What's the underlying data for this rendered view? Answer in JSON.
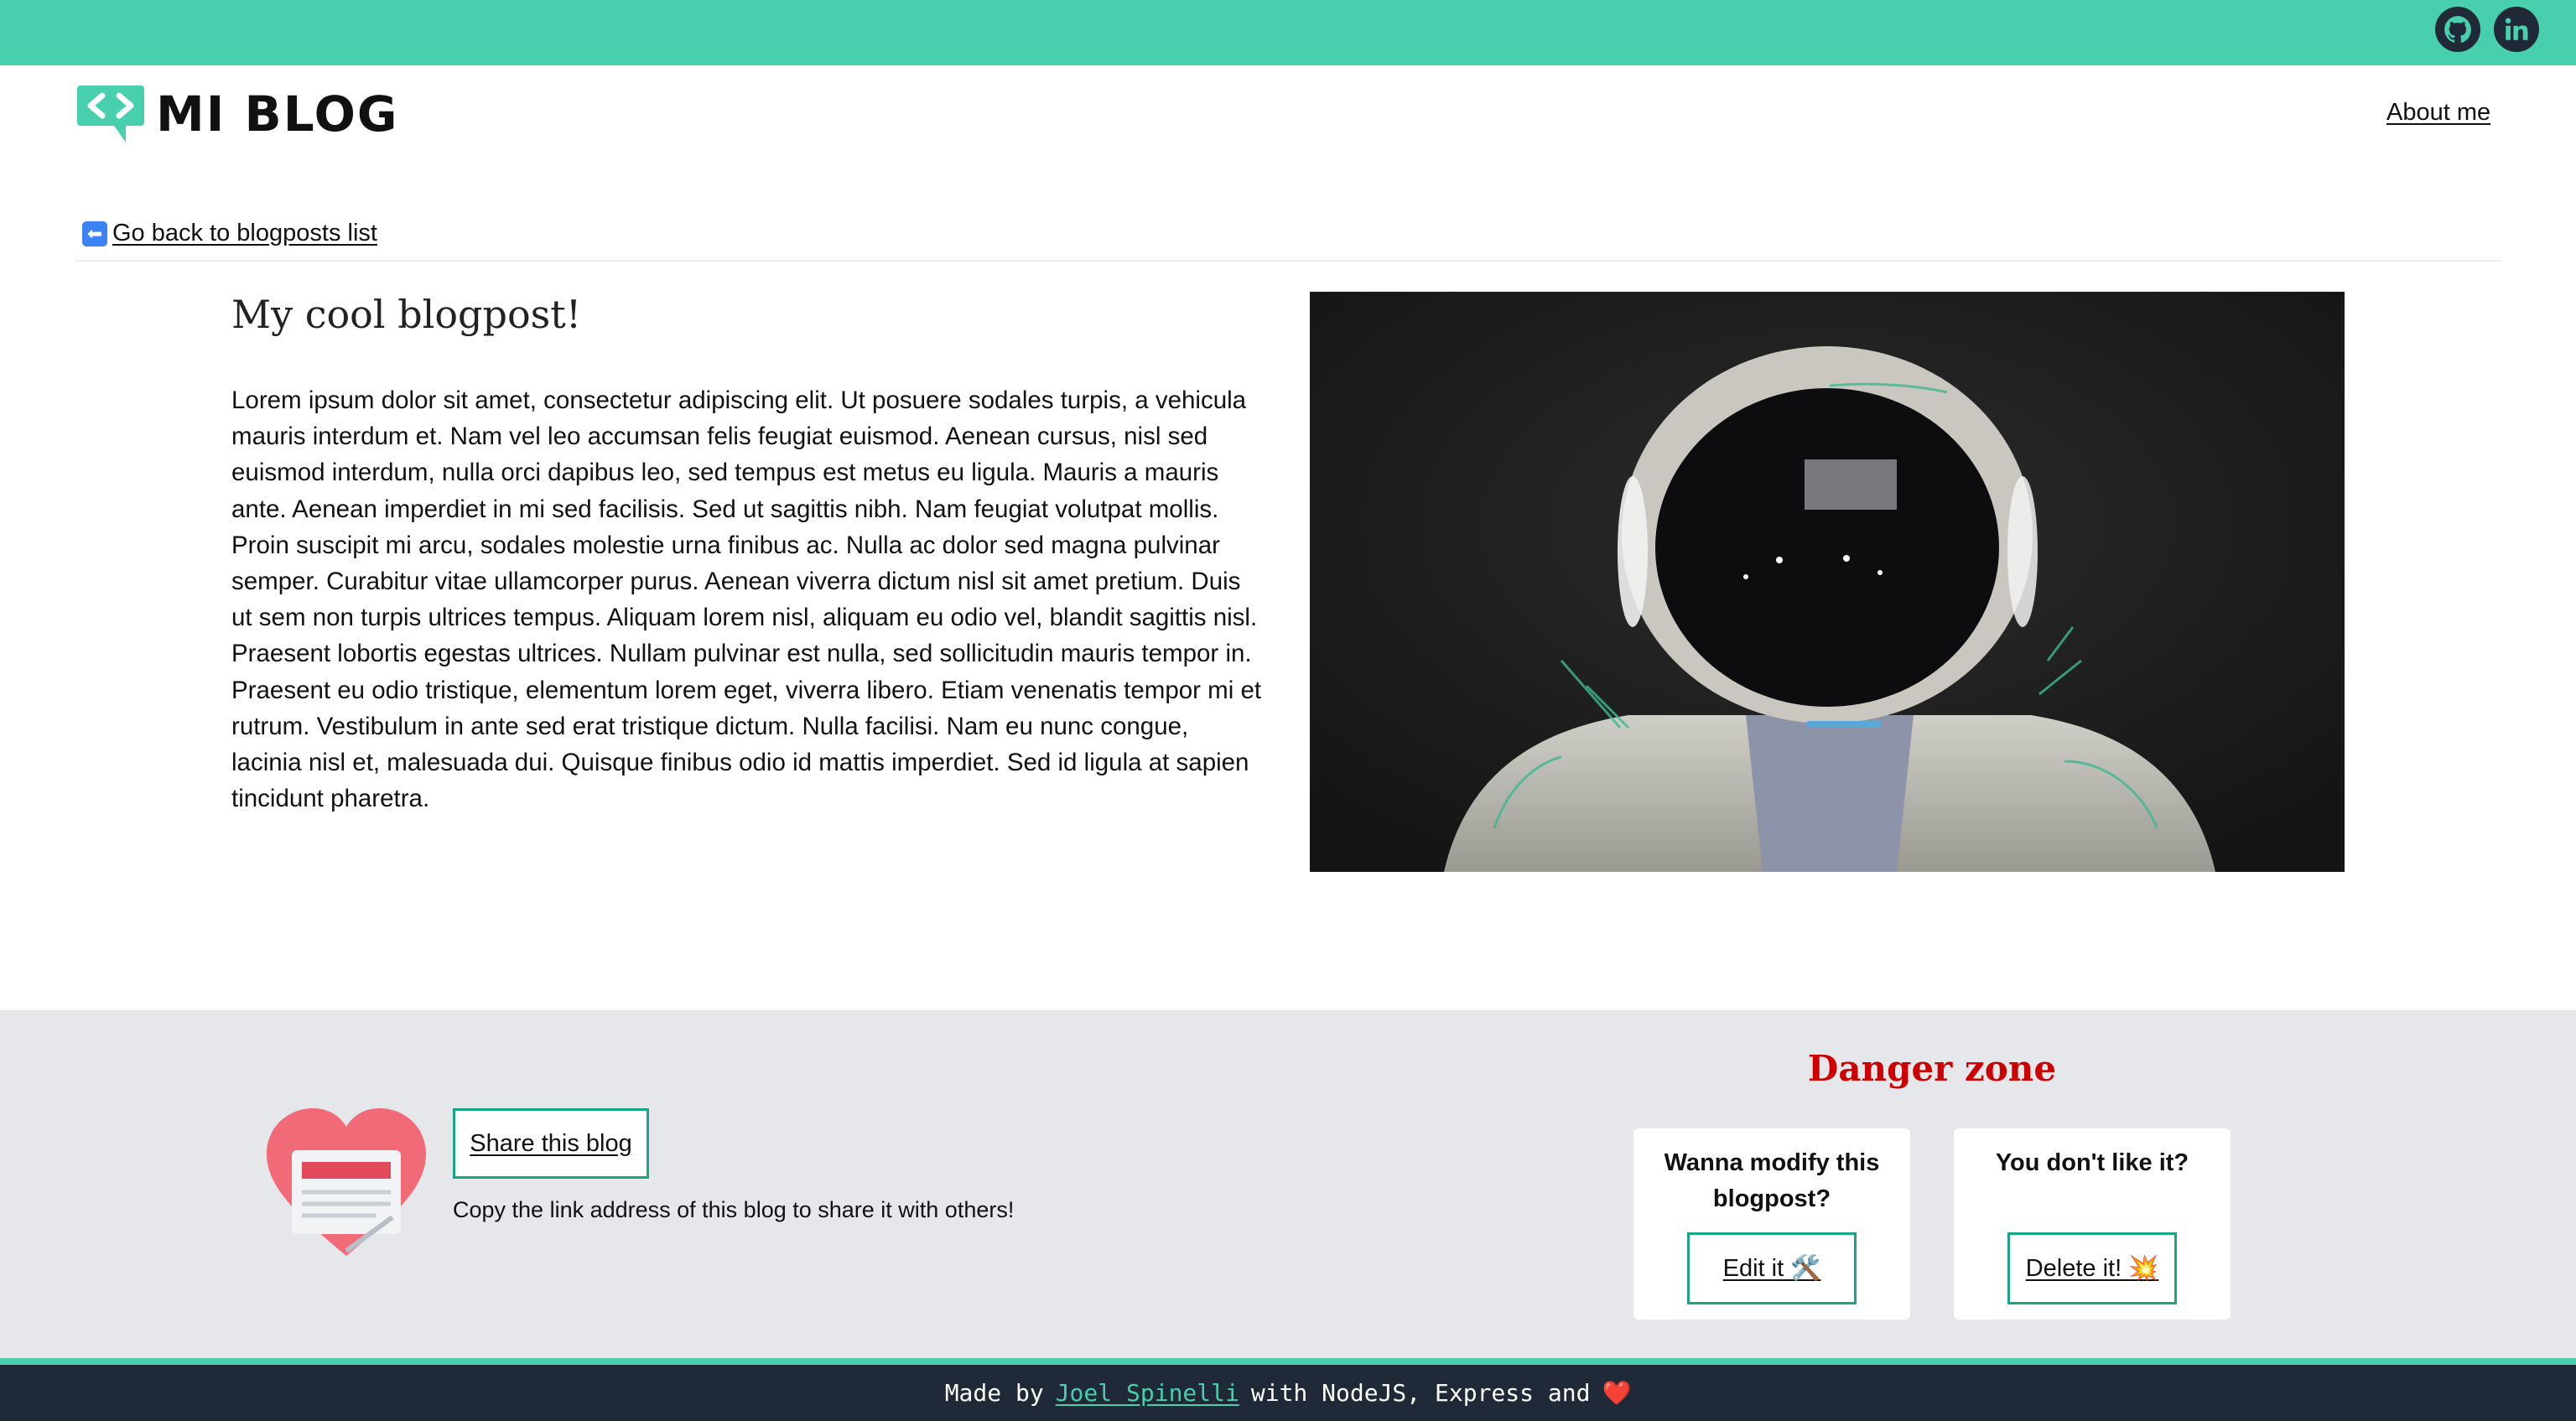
{
  "header": {
    "logo_text": "MI BLOG",
    "about_link": "About me",
    "social": [
      "github-icon",
      "linkedin-icon"
    ]
  },
  "nav": {
    "back_link": "Go back to blogposts list"
  },
  "post": {
    "title": "My cool blogpost!",
    "body": "Lorem ipsum dolor sit amet, consectetur adipiscing elit. Ut posuere sodales turpis, a vehicula mauris interdum et. Nam vel leo accumsan felis feugiat euismod. Aenean cursus, nisl sed euismod interdum, nulla orci dapibus leo, sed tempus est metus eu ligula. Mauris a mauris ante. Aenean imperdiet in mi sed facilisis. Sed ut sagittis nibh. Nam feugiat volutpat mollis. Proin suscipit mi arcu, sodales molestie urna finibus ac. Nulla ac dolor sed magna pulvinar semper. Curabitur vitae ullamcorper purus. Aenean viverra dictum nisl sit amet pretium. Duis ut sem non turpis ultrices tempus. Aliquam lorem nisl, aliquam eu odio vel, blandit sagittis nisl. Praesent lobortis egestas ultrices. Nullam pulvinar est nulla, sed sollicitudin mauris tempor in. Praesent eu odio tristique, elementum lorem eget, viverra libero. Etiam venenatis tempor mi et rutrum. Vestibulum in ante sed erat tristique dictum. Nulla facilisi. Nam eu nunc congue, lacinia nisl et, malesuada dui. Quisque finibus odio id mattis imperdiet. Sed id ligula at sapien tincidunt pharetra."
  },
  "share": {
    "button": "Share this blog",
    "description": "Copy the link address of this blog to share it with others!"
  },
  "danger": {
    "title": "Danger zone",
    "modify_question": "Wanna modify this blogpost?",
    "modify_button": "Edit it 🛠️",
    "delete_question": "You don't like it?",
    "delete_button": "Delete it! 💥"
  },
  "footer": {
    "prefix": "Made by",
    "author": "Joel Spinelli",
    "suffix": "with NodeJS, Express and",
    "heart": "❤️"
  },
  "colors": {
    "accent": "#48cfad",
    "danger": "#cc0000",
    "footer_bg": "#1f2937",
    "section_bg": "#e5e7eb"
  }
}
